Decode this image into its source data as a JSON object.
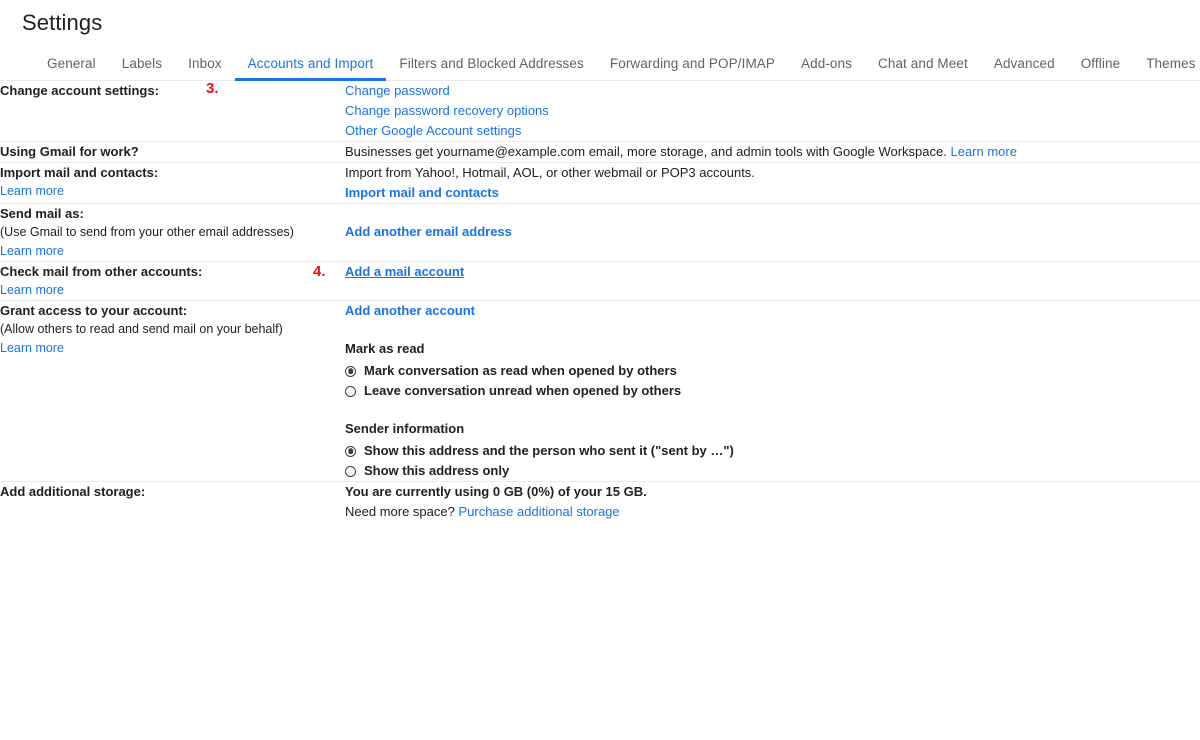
{
  "header": {
    "title": "Settings"
  },
  "markers": {
    "step3": "3.",
    "step4": "4."
  },
  "tabs": [
    {
      "label": "General",
      "active": false
    },
    {
      "label": "Labels",
      "active": false
    },
    {
      "label": "Inbox",
      "active": false
    },
    {
      "label": "Accounts and Import",
      "active": true
    },
    {
      "label": "Filters and Blocked Addresses",
      "active": false
    },
    {
      "label": "Forwarding and POP/IMAP",
      "active": false
    },
    {
      "label": "Add-ons",
      "active": false
    },
    {
      "label": "Chat and Meet",
      "active": false
    },
    {
      "label": "Advanced",
      "active": false
    },
    {
      "label": "Offline",
      "active": false
    },
    {
      "label": "Themes",
      "active": false
    }
  ],
  "sections": {
    "change_account": {
      "label": "Change account settings:",
      "links": [
        "Change password",
        "Change password recovery options",
        "Other Google Account settings"
      ]
    },
    "gmail_for_work": {
      "label": "Using Gmail for work?",
      "text": "Businesses get yourname@example.com email, more storage, and admin tools with Google Workspace.",
      "link": "Learn more"
    },
    "import_mail": {
      "label": "Import mail and contacts:",
      "learn_more": "Learn more",
      "description": "Import from Yahoo!, Hotmail, AOL, or other webmail or POP3 accounts.",
      "action": "Import mail and contacts"
    },
    "send_mail_as": {
      "label": "Send mail as:",
      "sublabel": "(Use Gmail to send from your other email addresses)",
      "learn_more": "Learn more",
      "action": "Add another email address"
    },
    "check_mail": {
      "label": "Check mail from other accounts:",
      "learn_more": "Learn more",
      "action": "Add a mail account"
    },
    "grant_access": {
      "label": "Grant access to your account:",
      "sublabel": "(Allow others to read and send mail on your behalf)",
      "learn_more": "Learn more",
      "action": "Add another account",
      "mark_as_read": {
        "title": "Mark as read",
        "options": [
          {
            "label": "Mark conversation as read when opened by others",
            "selected": true
          },
          {
            "label": "Leave conversation unread when opened by others",
            "selected": false
          }
        ]
      },
      "sender_information": {
        "title": "Sender information",
        "options": [
          {
            "label": "Show this address and the person who sent it (\"sent by …\")",
            "selected": true
          },
          {
            "label": "Show this address only",
            "selected": false
          }
        ]
      }
    },
    "storage": {
      "label": "Add additional storage:",
      "usage": "You are currently using 0 GB (0%) of your 15 GB.",
      "need_space": "Need more space?",
      "purchase_link": "Purchase additional storage"
    }
  },
  "colors": {
    "link": "#1a73e8",
    "marker": "#e8120b",
    "divider": "#e8eaed",
    "text": "#202124",
    "muted": "#5f6368"
  }
}
